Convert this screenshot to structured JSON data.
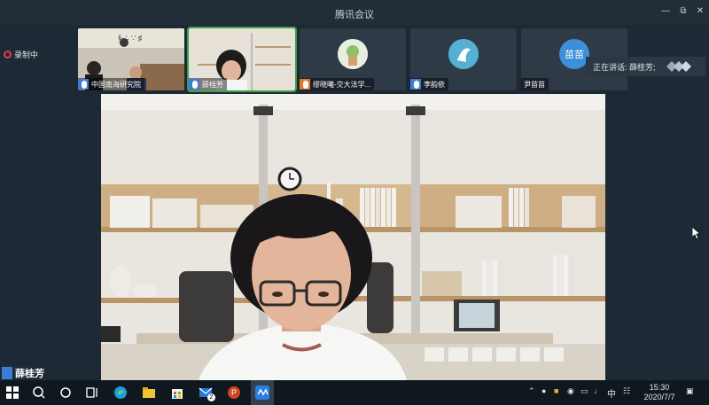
{
  "window": {
    "title": "腾讯会议"
  },
  "recording": {
    "label": "录制中"
  },
  "participants": [
    {
      "name": "中国南海研究院"
    },
    {
      "name": "薛桂芳"
    },
    {
      "name": "缪晓曦-交大法学..."
    },
    {
      "name": "李韵依"
    },
    {
      "name": "尹苗苗",
      "avatar_text": "苗苗"
    }
  ],
  "speaking": {
    "label": "正在讲话: 薛桂芳;"
  },
  "main_speaker": {
    "name": "薛桂芳"
  },
  "taskbar": {
    "mail_badge": "2",
    "ime": "中",
    "time": "15:30",
    "date": "2020/7/7"
  },
  "colors": {
    "accent": "#3d7bd9",
    "active_border": "#3aa24a",
    "record": "#e04040"
  }
}
